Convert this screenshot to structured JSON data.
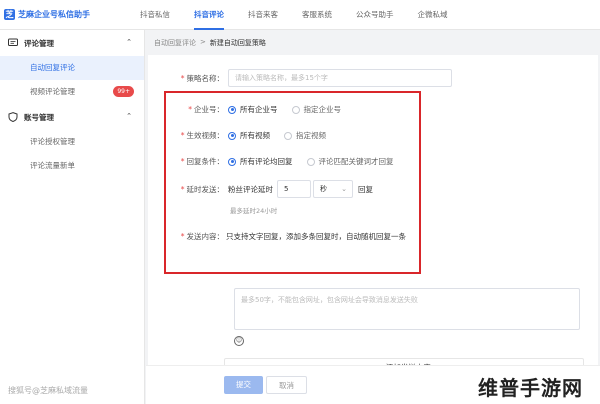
{
  "app": {
    "title": "芝麻企业号私信助手"
  },
  "nav": {
    "items": [
      "抖音私信",
      "抖音评论",
      "抖音来客",
      "客服系统",
      "公众号助手",
      "企微私域"
    ],
    "active": "抖音评论"
  },
  "sidebar": {
    "groups": [
      {
        "title": "评论管理",
        "icon": "chat-icon",
        "items": [
          {
            "label": "自动回复评论",
            "active": true
          },
          {
            "label": "视频评论管理",
            "badge": "99+"
          }
        ]
      },
      {
        "title": "账号管理",
        "icon": "shield-icon",
        "items": [
          {
            "label": "评论授权管理"
          },
          {
            "label": "评论流量新单"
          }
        ]
      }
    ]
  },
  "breadcrumb": {
    "parent": "自动回复评论",
    "sep": ">",
    "current": "新建自动回复策略"
  },
  "form": {
    "strategy": {
      "label": "策略名称：",
      "placeholder": "请输入策略名称，最多15个字"
    },
    "account": {
      "label": "企业号：",
      "opt1": "所有企业号",
      "opt2": "指定企业号"
    },
    "video": {
      "label": "生效视频：",
      "opt1": "所有视频",
      "opt2": "指定视频"
    },
    "condition": {
      "label": "回复条件：",
      "opt1": "所有评论均回复",
      "opt2": "评论匹配关键词才回复"
    },
    "delay": {
      "label": "延时发送：",
      "prefix": "粉丝评论延时",
      "value": "5",
      "unit": "秒",
      "suffix": "回复",
      "hint": "最多延时24小时"
    },
    "content": {
      "label": "发送内容：",
      "note": "只支持文字回复，添加多条回复时，自动随机回复一条"
    },
    "textarea_placeholder": "最多50字，不能包含网址，包含网址会导致消息发送失败",
    "add_label": "+ 添加发送内容"
  },
  "footer": {
    "submit": "提交",
    "cancel": "取消"
  },
  "watermarks": {
    "left": "搜狐号@芝麻私域流量",
    "right": "维普手游网"
  },
  "colors": {
    "accent": "#2f6fe4",
    "highlight_box": "#d9262a",
    "badge": "#e84a4a"
  }
}
